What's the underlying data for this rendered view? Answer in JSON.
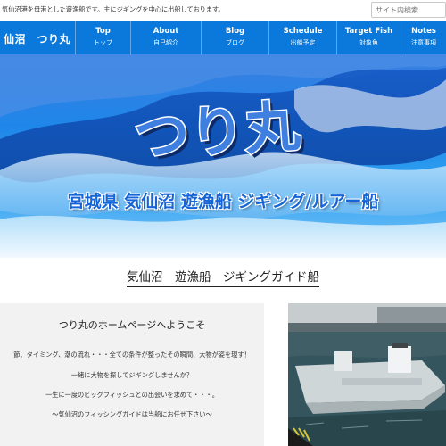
{
  "header": {
    "tagline": "気仙沼港を母港とした遊漁船です。主にジギングを中心に出船しております。",
    "search_placeholder": "サイト内検索"
  },
  "nav": {
    "brand": "仙沼　つり丸",
    "items": [
      {
        "en": "Top",
        "jp": "トップ"
      },
      {
        "en": "About",
        "jp": "自己紹介"
      },
      {
        "en": "Blog",
        "jp": "ブログ"
      },
      {
        "en": "Schedule",
        "jp": "出船予定"
      },
      {
        "en": "Target Fish",
        "jp": "対象魚"
      },
      {
        "en": "Notes",
        "jp": "注意事項"
      }
    ],
    "bg_color": "#0a79db"
  },
  "hero": {
    "logo_text": "つり丸",
    "title": "宮城県 気仙沼 遊漁船 ジギング/ルアー船"
  },
  "section_heading": "気仙沼　遊漁船　ジギングガイド船",
  "welcome": {
    "title": "つり丸のホームページへようこそ",
    "lines": [
      "節、タイミング、潮の流れ・・・全ての条件が整ったその瞬間、大物が姿を現す！",
      "一緒に大物を探してジギングしませんか？",
      "一生に一度のビッグフィッシュとの出会いを求めて・・・。",
      "～気仙沼のフィッシングガイドは当船にお任せ下さい～"
    ]
  },
  "photo": {
    "subject": "boat-photo"
  }
}
